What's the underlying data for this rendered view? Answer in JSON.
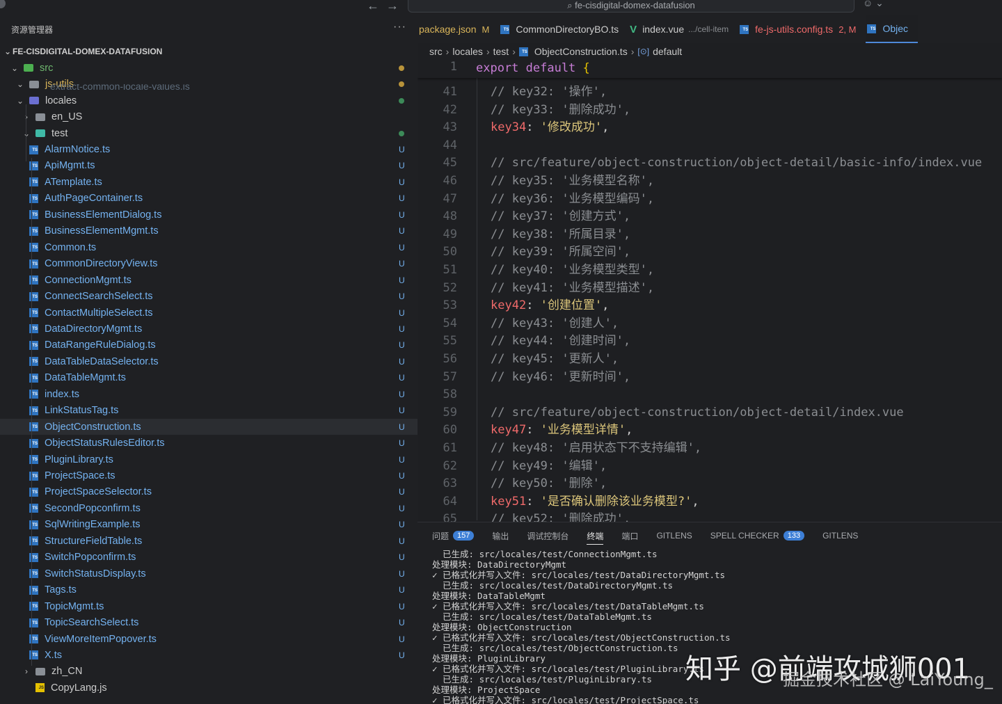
{
  "titlebar": {
    "search": "fe-cisdigital-domex-datafusion",
    "back_icon": "arrow-left",
    "forward_icon": "arrow-right"
  },
  "sidebar": {
    "title": "资源管理器",
    "more": "···",
    "root": "FE-CISDIGITAL-DOMEX-DATAFUSION",
    "items": [
      {
        "label": "src",
        "type": "folder-src",
        "open": true
      },
      {
        "label": "js-utils",
        "type": "folder",
        "open": true
      },
      {
        "label": "locales",
        "type": "folder-locales",
        "open": true
      },
      {
        "label": "en_US",
        "type": "folder",
        "open": false
      },
      {
        "label": "test",
        "type": "folder-test",
        "open": true
      },
      {
        "label": "AlarmNotice.ts",
        "status": "U"
      },
      {
        "label": "ApiMgmt.ts",
        "status": "U"
      },
      {
        "label": "ATemplate.ts",
        "status": "U"
      },
      {
        "label": "AuthPageContainer.ts",
        "status": "U"
      },
      {
        "label": "BusinessElementDialog.ts",
        "status": "U"
      },
      {
        "label": "BusinessElementMgmt.ts",
        "status": "U"
      },
      {
        "label": "Common.ts",
        "status": "U"
      },
      {
        "label": "CommonDirectoryView.ts",
        "status": "U"
      },
      {
        "label": "ConnectionMgmt.ts",
        "status": "U"
      },
      {
        "label": "ConnectSearchSelect.ts",
        "status": "U"
      },
      {
        "label": "ContactMultipleSelect.ts",
        "status": "U"
      },
      {
        "label": "DataDirectoryMgmt.ts",
        "status": "U"
      },
      {
        "label": "DataRangeRuleDialog.ts",
        "status": "U"
      },
      {
        "label": "DataTableDataSelector.ts",
        "status": "U"
      },
      {
        "label": "DataTableMgmt.ts",
        "status": "U"
      },
      {
        "label": "index.ts",
        "status": "U"
      },
      {
        "label": "LinkStatusTag.ts",
        "status": "U"
      },
      {
        "label": "ObjectConstruction.ts",
        "status": "U",
        "selected": true
      },
      {
        "label": "ObjectStatusRulesEditor.ts",
        "status": "U"
      },
      {
        "label": "PluginLibrary.ts",
        "status": "U"
      },
      {
        "label": "ProjectSpace.ts",
        "status": "U"
      },
      {
        "label": "ProjectSpaceSelector.ts",
        "status": "U"
      },
      {
        "label": "SecondPopconfirm.ts",
        "status": "U"
      },
      {
        "label": "SqlWritingExample.ts",
        "status": "U"
      },
      {
        "label": "StructureFieldTable.ts",
        "status": "U"
      },
      {
        "label": "SwitchPopconfirm.ts",
        "status": "U"
      },
      {
        "label": "SwitchStatusDisplay.ts",
        "status": "U"
      },
      {
        "label": "Tags.ts",
        "status": "U"
      },
      {
        "label": "TopicMgmt.ts",
        "status": "U"
      },
      {
        "label": "TopicSearchSelect.ts",
        "status": "U"
      },
      {
        "label": "ViewMoreItemPopover.ts",
        "status": "U"
      },
      {
        "label": "X.ts",
        "status": "U"
      },
      {
        "label": "zh_CN",
        "type": "folder",
        "open": false
      },
      {
        "label": "CopyLang.js",
        "type": "js"
      }
    ],
    "hidden_file_peek": "extract-common-locale-values.js"
  },
  "tabs": [
    {
      "label": "package.json",
      "mod": "M",
      "color": "#d9b55a"
    },
    {
      "label": "CommonDirectoryBO.ts",
      "mod": "",
      "color": "#cccccc"
    },
    {
      "label": "index.vue",
      "sub": ".../cell-item",
      "color": "#cccccc"
    },
    {
      "label": "fe-js-utils.config.ts",
      "mod": "2, M",
      "color": "#ef6a6a"
    },
    {
      "label": "Objec",
      "mod": "",
      "color": "#74b2f0",
      "active": true
    }
  ],
  "breadcrumb": [
    "src",
    "locales",
    "test",
    "ObjectConstruction.ts",
    "default"
  ],
  "editor": {
    "sticky": {
      "num": "1",
      "text": "export default {"
    },
    "lines": [
      {
        "num": "41",
        "kind": "cm",
        "text": "// key32: '操作',"
      },
      {
        "num": "42",
        "kind": "cm",
        "text": "// key33: '删除成功',"
      },
      {
        "num": "43",
        "kind": "kv",
        "key": "key34",
        "val": "'修改成功'"
      },
      {
        "num": "44",
        "kind": "blank",
        "text": ""
      },
      {
        "num": "45",
        "kind": "cm",
        "text": "// src/feature/object-construction/object-detail/basic-info/index.vue"
      },
      {
        "num": "46",
        "kind": "cm",
        "text": "// key35: '业务模型名称',"
      },
      {
        "num": "47",
        "kind": "cm",
        "text": "// key36: '业务模型编码',"
      },
      {
        "num": "48",
        "kind": "cm",
        "text": "// key37: '创建方式',"
      },
      {
        "num": "49",
        "kind": "cm",
        "text": "// key38: '所属目录',"
      },
      {
        "num": "50",
        "kind": "cm",
        "text": "// key39: '所属空间',"
      },
      {
        "num": "51",
        "kind": "cm",
        "text": "// key40: '业务模型类型',"
      },
      {
        "num": "52",
        "kind": "cm",
        "text": "// key41: '业务模型描述',"
      },
      {
        "num": "53",
        "kind": "kv",
        "key": "key42",
        "val": "'创建位置'"
      },
      {
        "num": "54",
        "kind": "cm",
        "text": "// key43: '创建人',"
      },
      {
        "num": "55",
        "kind": "cm",
        "text": "// key44: '创建时间',"
      },
      {
        "num": "56",
        "kind": "cm",
        "text": "// key45: '更新人',"
      },
      {
        "num": "57",
        "kind": "cm",
        "text": "// key46: '更新时间',"
      },
      {
        "num": "58",
        "kind": "blank",
        "text": ""
      },
      {
        "num": "59",
        "kind": "cm",
        "text": "// src/feature/object-construction/object-detail/index.vue"
      },
      {
        "num": "60",
        "kind": "kv",
        "key": "key47",
        "val": "'业务模型详情'"
      },
      {
        "num": "61",
        "kind": "cm",
        "text": "// key48: '启用状态下不支持编辑',"
      },
      {
        "num": "62",
        "kind": "cm",
        "text": "// key49: '编辑',"
      },
      {
        "num": "63",
        "kind": "cm",
        "text": "// key50: '删除',"
      },
      {
        "num": "64",
        "kind": "kv",
        "key": "key51",
        "val": "'是否确认删除该业务模型?'"
      },
      {
        "num": "65",
        "kind": "cm",
        "text": "// key52: '删除成功',"
      }
    ]
  },
  "panel": {
    "tabs": [
      {
        "label": "问题",
        "badge": "157"
      },
      {
        "label": "输出"
      },
      {
        "label": "调试控制台"
      },
      {
        "label": "终端",
        "active": true
      },
      {
        "label": "端口"
      },
      {
        "label": "GITLENS"
      },
      {
        "label": "SPELL CHECKER",
        "badge": "133"
      },
      {
        "label": "GITLENS"
      }
    ],
    "terminal": [
      "  已生成: src/locales/test/ConnectionMgmt.ts",
      "处理模块: DataDirectoryMgmt",
      "✓ 已格式化并写入文件: src/locales/test/DataDirectoryMgmt.ts",
      "  已生成: src/locales/test/DataDirectoryMgmt.ts",
      "处理模块: DataTableMgmt",
      "✓ 已格式化并写入文件: src/locales/test/DataTableMgmt.ts",
      "  已生成: src/locales/test/DataTableMgmt.ts",
      "处理模块: ObjectConstruction",
      "✓ 已格式化并写入文件: src/locales/test/ObjectConstruction.ts",
      "  已生成: src/locales/test/ObjectConstruction.ts",
      "处理模块: PluginLibrary",
      "✓ 已格式化并写入文件: src/locales/test/PluginLibrary.ts",
      "  已生成: src/locales/test/PluginLibrary.ts",
      "处理模块: ProjectSpace",
      "✓ 已格式化并写入文件: src/locales/test/ProjectSpace.ts"
    ],
    "watermark": "知乎 @前端攻城狮001",
    "watermark2": "掘金技术社区 @ LaiYoung_"
  }
}
